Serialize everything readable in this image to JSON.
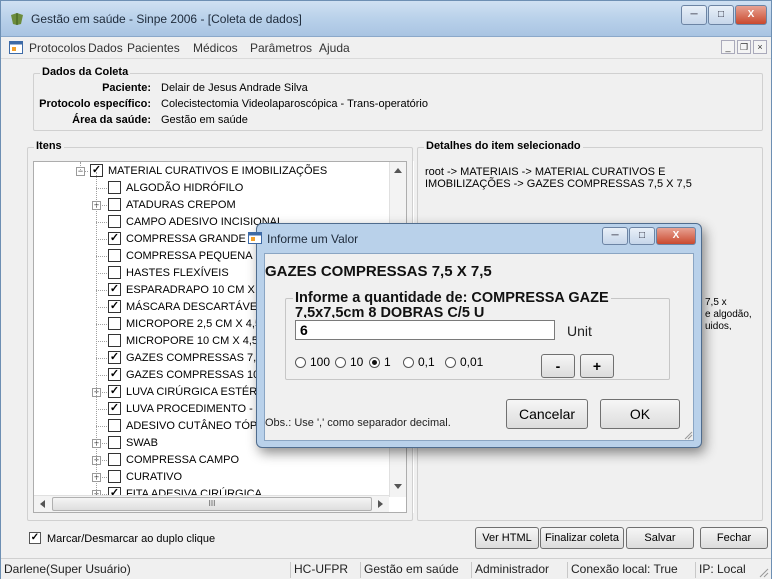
{
  "window": {
    "title": "Gestão em saúde - Sinpe 2006 - [Coleta de dados]",
    "buttons": {
      "minimize": "─",
      "maximize": "□",
      "close": "X"
    }
  },
  "menu": {
    "items": [
      "Protocolos",
      "Dados",
      "Pacientes",
      "Médicos",
      "Parâmetros",
      "Ajuda"
    ],
    "mdi": {
      "minimize": "_",
      "restore": "❐",
      "close": "×"
    }
  },
  "dados_coleta": {
    "title": "Dados da Coleta",
    "paciente_label": "Paciente:",
    "paciente_value": "Delair de Jesus Andrade Silva",
    "protocolo_label": "Protocolo específico:",
    "protocolo_value": "Colecistectomia Videolaparoscópica - Trans-operatório",
    "area_label": "Área da saúde:",
    "area_value": "Gestão em saúde"
  },
  "itens": {
    "title": "Itens",
    "rows": [
      {
        "label": "MATERIAL CURATIVOS E IMOBILIZAÇÕES",
        "checked": true,
        "expander": "−"
      },
      {
        "label": "ALGODÃO HIDRÓFILO",
        "checked": false,
        "expander": ""
      },
      {
        "label": "ATADURAS CREPOM",
        "checked": false,
        "expander": "+"
      },
      {
        "label": "CAMPO ADESIVO INCISIONAL",
        "checked": false,
        "expander": ""
      },
      {
        "label": "COMPRESSA GRANDE - CO",
        "checked": true,
        "expander": ""
      },
      {
        "label": "COMPRESSA PEQUENA",
        "checked": false,
        "expander": ""
      },
      {
        "label": "HASTES FLEXÍVEIS",
        "checked": false,
        "expander": ""
      },
      {
        "label": "ESPARADRAPO 10 CM X 4,",
        "checked": true,
        "expander": ""
      },
      {
        "label": "MÁSCARA DESCARTÁVEL",
        "checked": true,
        "expander": ""
      },
      {
        "label": "MICROPORE 2,5 CM X 4,5 M",
        "checked": false,
        "expander": ""
      },
      {
        "label": "MICROPORE 10 CM X 4,5 M",
        "checked": false,
        "expander": ""
      },
      {
        "label": "GAZES COMPRESSAS 7,5 X",
        "checked": true,
        "expander": ""
      },
      {
        "label": "GAZES COMPRESSAS 10 X",
        "checked": true,
        "expander": ""
      },
      {
        "label": "LUVA CIRÚRGICA ESTÉRIL",
        "checked": true,
        "expander": "+"
      },
      {
        "label": "LUVA PROCEDIMENTO - LU",
        "checked": true,
        "expander": ""
      },
      {
        "label": "ADESIVO CUTÂNEO TÓPICO",
        "checked": false,
        "expander": ""
      },
      {
        "label": "SWAB",
        "checked": false,
        "expander": "+"
      },
      {
        "label": "COMPRESSA CAMPO",
        "checked": false,
        "expander": "+"
      },
      {
        "label": "CURATIVO",
        "checked": false,
        "expander": "+"
      },
      {
        "label": "FITA ADESIVA CIRÚRGICA",
        "checked": true,
        "expander": "+"
      }
    ],
    "hscroll_thumb": "III"
  },
  "detalhes": {
    "title": "Detalhes do item selecionado",
    "path_line1": "root -> MATERIAIS -> MATERIAL CURATIVOS E",
    "path_line2": "IMOBILIZAÇÕES -> GAZES COMPRESSAS 7,5 X 7,5",
    "partial_1": "7,5 x",
    "partial_2": "e algodão,",
    "partial_3": "uidos,"
  },
  "bottom": {
    "checkbox_label": "Marcar/Desmarcar ao duplo clique",
    "checkbox_checked": true,
    "buttons": [
      "Ver HTML",
      "Finalizar coleta",
      "Salvar",
      "Fechar"
    ]
  },
  "statusbar": [
    "Darlene(Super Usuário)",
    "HC-UFPR",
    "Gestão em saúde",
    "Administrador",
    "Conexão local: True",
    "IP: Local"
  ],
  "dialog": {
    "title": "Informe um Valor",
    "heading": "GAZES COMPRESSAS 7,5 X 7,5",
    "group_line1": "Informe a quantidade de: COMPRESSA GAZE",
    "group_line2": "7,5x7,5cm  8 DOBRAS C/5 U",
    "value": "6",
    "unit": "Unit",
    "steps": [
      "100",
      "10",
      "1",
      "0,1",
      "0,01"
    ],
    "selected_step": "1",
    "minus": "-",
    "plus": "+",
    "obs": "Obs.: Use ',' como separador decimal.",
    "cancel": "Cancelar",
    "ok": "OK"
  }
}
